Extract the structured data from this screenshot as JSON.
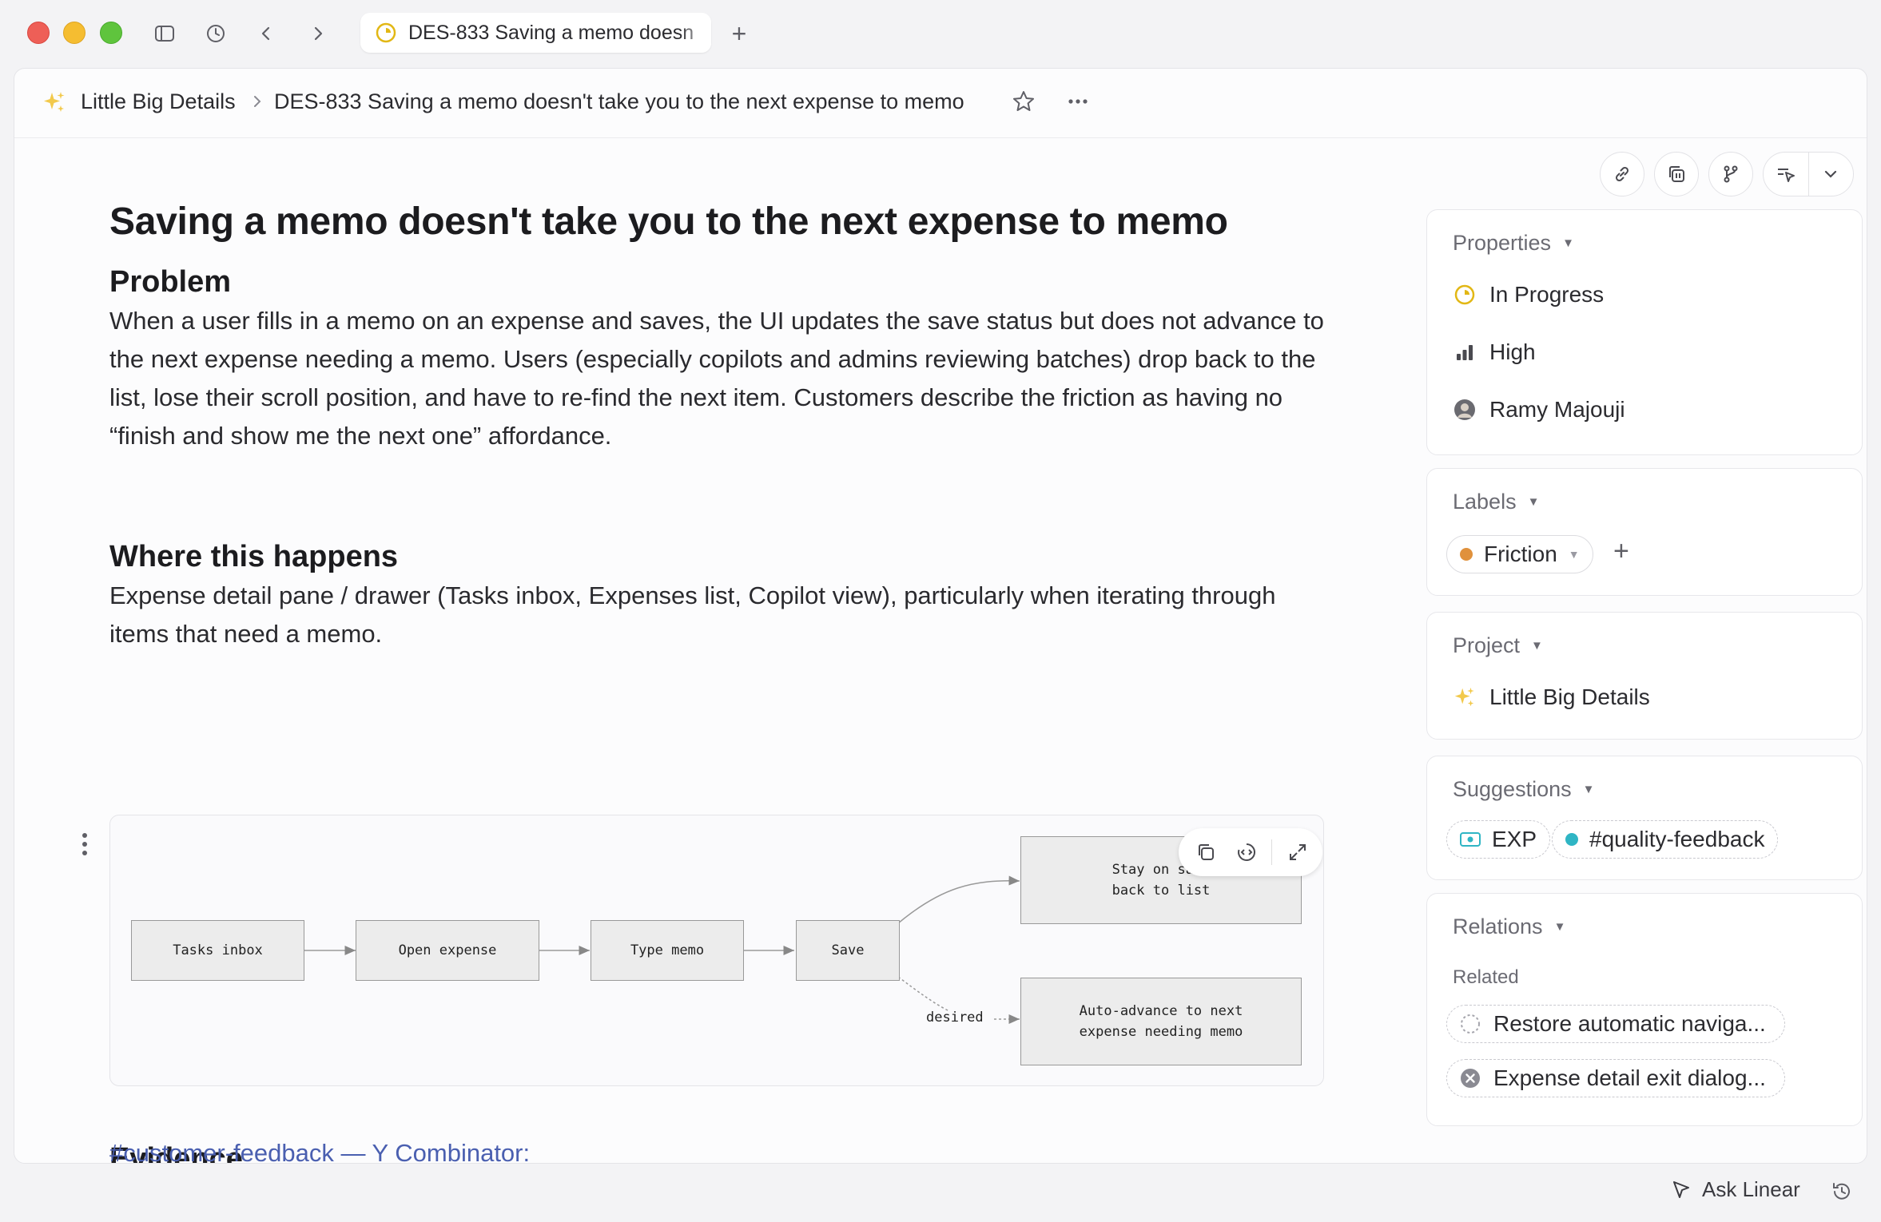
{
  "tab": {
    "title": "DES-833 Saving a memo doesn"
  },
  "breadcrumb": {
    "project": "Little Big Details",
    "issue": "DES-833  Saving a memo doesn't take you to the next expense to memo"
  },
  "document": {
    "title": "Saving a memo doesn't take you to the next expense to memo",
    "problem_heading": "Problem",
    "problem_text": "When a user fills in a memo on an expense and saves, the UI updates the save status but does not advance to the next expense needing a memo. Users (especially copilots and admins reviewing batches) drop back to the list, lose their scroll position, and have to re-find the next item. Customers describe the friction as having no “finish and show me the next one” affordance.",
    "where_heading": "Where this happens",
    "where_text": "Expense detail pane / drawer (Tasks inbox, Expenses list, Copilot view), particularly when iterating through items that need a memo.",
    "evidence_heading": "Evidence",
    "evidence_link": "#customer-feedback — Y Combinator:"
  },
  "diagram": {
    "nodes": {
      "tasks_inbox": "Tasks inbox",
      "open_expense": "Open expense",
      "type_memo": "Type memo",
      "save": "Save",
      "stay_line1": "Stay on same",
      "stay_line2": "back to list",
      "auto_line1": "Auto-advance to next",
      "auto_line2": "expense needing memo"
    },
    "edge_label": "desired"
  },
  "sidebar": {
    "properties": {
      "title": "Properties",
      "status": "In Progress",
      "priority": "High",
      "assignee": "Ramy Majouji"
    },
    "labels": {
      "title": "Labels",
      "label": "Friction"
    },
    "project": {
      "title": "Project",
      "name": "Little Big Details"
    },
    "suggestions": {
      "title": "Suggestions",
      "team": "EXP",
      "channel": "#quality-feedback"
    },
    "relations": {
      "title": "Relations",
      "related_label": "Related",
      "items": [
        "Restore automatic naviga...",
        "Expense detail exit dialog..."
      ]
    }
  },
  "bottom": {
    "ask": "Ask Linear"
  },
  "colors": {
    "status_yellow": "#e2b714",
    "label_orange": "#e0913c",
    "channel_teal": "#2fb5c4",
    "link_blue": "#4a5fb0"
  }
}
